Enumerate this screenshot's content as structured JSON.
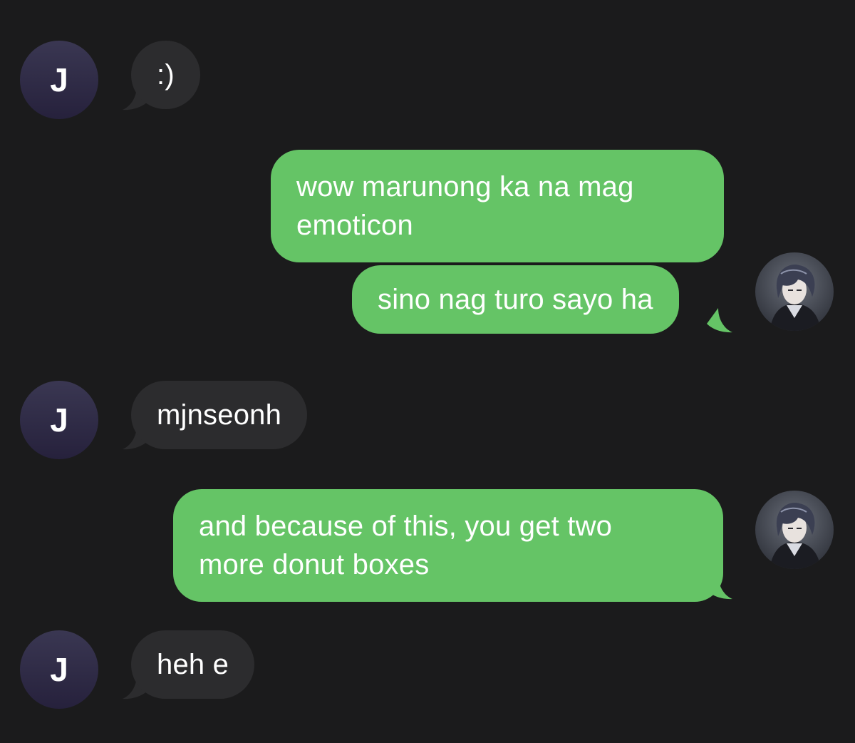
{
  "contact": {
    "initial": "J"
  },
  "colors": {
    "background": "#1b1b1c",
    "incoming_bubble": "#2c2c2e",
    "outgoing_bubble": "#65c466",
    "avatar": "#302c48"
  },
  "messages": [
    {
      "sender": "them",
      "text": ":)"
    },
    {
      "sender": "me",
      "lines": [
        "wow marunong ka na mag",
        "emoticon"
      ]
    },
    {
      "sender": "me",
      "text": "sino nag turo sayo ha"
    },
    {
      "sender": "them",
      "text": "mjnseonh"
    },
    {
      "sender": "me",
      "lines": [
        "and because of this, you get two",
        "more donut boxes"
      ]
    },
    {
      "sender": "them",
      "text": "heh e"
    }
  ],
  "my_avatar": {
    "icon": "anime-profile-avatar"
  }
}
